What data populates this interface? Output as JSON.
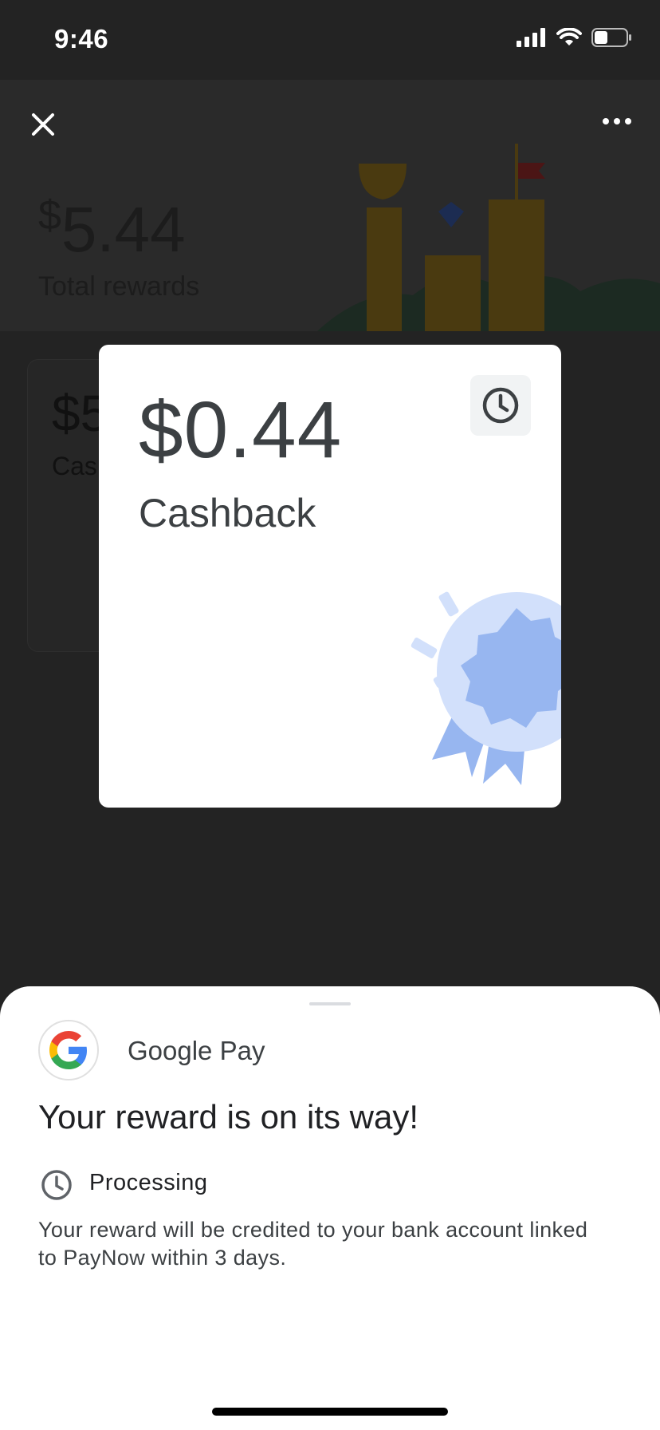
{
  "status_bar": {
    "time": "9:46"
  },
  "header": {
    "total_currency": "$",
    "total_amount": "5.44",
    "total_label": "Total rewards"
  },
  "background_card": {
    "amount": "$5",
    "label": "Cas"
  },
  "reward_card": {
    "amount": "$0.44",
    "label": "Cashback"
  },
  "sheet": {
    "app_name": "Google Pay",
    "title": "Your reward is on its way!",
    "status": "Processing",
    "description": "Your reward will be credited to your bank account linked to PayNow within 3 days."
  },
  "colors": {
    "overlay_bg": "#232323",
    "card_bg": "#ffffff",
    "badge_blue": "#97b6f0",
    "badge_light": "#d2e0fb",
    "text_dark": "#3c4043"
  },
  "icons": [
    "close-icon",
    "more-icon",
    "clock-icon",
    "google-g-icon",
    "signal-icon",
    "wifi-icon",
    "battery-icon"
  ]
}
